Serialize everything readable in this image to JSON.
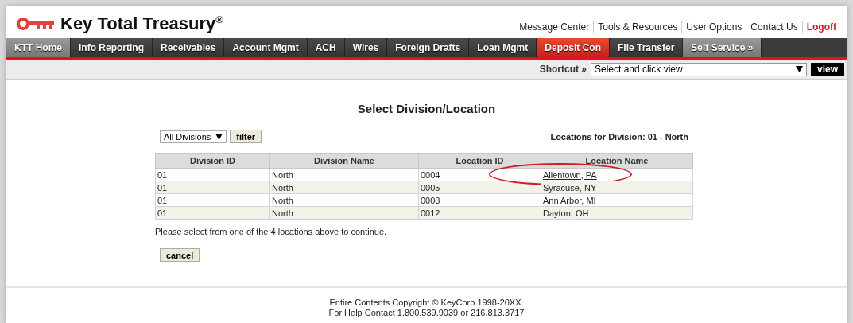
{
  "header": {
    "brand": "Key Total Treasury$^{®}$",
    "links": [
      {
        "label": "Message Center",
        "kind": "normal"
      },
      {
        "label": "Tools & Resources",
        "kind": "normal"
      },
      {
        "label": "User Options",
        "kind": "normal"
      },
      {
        "label": "Contact Us",
        "kind": "normal"
      },
      {
        "label": "Logoff",
        "kind": "logoff"
      }
    ]
  },
  "nav": [
    {
      "label": "KTT Home",
      "kind": "light",
      "selected": false
    },
    {
      "label": "Info Reporting",
      "kind": "dark",
      "selected": false
    },
    {
      "label": "Receivables",
      "kind": "dark",
      "selected": false
    },
    {
      "label": "Account Mgmt",
      "kind": "dark",
      "selected": false
    },
    {
      "label": "ACH",
      "kind": "dark",
      "selected": false
    },
    {
      "label": "Wires",
      "kind": "dark",
      "selected": false
    },
    {
      "label": "Foreign Drafts",
      "kind": "dark",
      "selected": false
    },
    {
      "label": "Loan Mgmt",
      "kind": "dark",
      "selected": false
    },
    {
      "label": "Deposit Con",
      "kind": "dark",
      "selected": true
    },
    {
      "label": "File Transfer",
      "kind": "dark",
      "selected": false
    },
    {
      "label": "Self Service »",
      "kind": "light",
      "selected": false
    }
  ],
  "shortcut": {
    "label": "Shortcut »",
    "value": "Select and click view",
    "button": "view"
  },
  "title": "Select Division/Location",
  "filter": {
    "value": "All Divisions",
    "button": "filter"
  },
  "locations_heading": "Locations for Division: 01 - North",
  "table": {
    "columns": [
      "Division ID",
      "Division Name",
      "Location ID",
      "Location Name"
    ],
    "rows": [
      {
        "cells": [
          "01",
          "North",
          "0004",
          "Allentown, PA"
        ],
        "circled": true
      },
      {
        "cells": [
          "01",
          "North",
          "0005",
          "Syracuse, NY"
        ],
        "circled": false
      },
      {
        "cells": [
          "01",
          "North",
          "0008",
          "Ann Arbor, MI"
        ],
        "circled": false
      },
      {
        "cells": [
          "01",
          "North",
          "0012",
          "Dayton, OH"
        ],
        "circled": false
      }
    ]
  },
  "instruction": "Please select from one of the 4 locations above to continue.",
  "cancel": "cancel",
  "footer": [
    "Entire Contents Copyright © KeyCorp 1998-20XX.",
    "For Help Contact 1.800.539.9039 or 216.813.3717"
  ]
}
